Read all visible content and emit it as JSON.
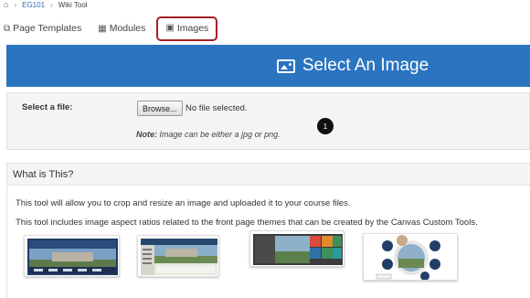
{
  "breadcrumb": {
    "items": [
      "EG101",
      "Wiki Tool"
    ]
  },
  "tabs": [
    {
      "label": "Page Templates",
      "icon": "page-templates-icon"
    },
    {
      "label": "Modules",
      "icon": "modules-icon"
    },
    {
      "label": "Images",
      "icon": "image-icon",
      "active": true
    }
  ],
  "header": {
    "title": "Select An Image"
  },
  "file_select": {
    "label": "Select a file:",
    "browse_label": "Browse...",
    "status": "No file selected.",
    "note_prefix": "Note:",
    "note_text": " Image can be either a jpg or png.",
    "callout": "1"
  },
  "info": {
    "heading": "What is This?",
    "line1": "This tool will allow you to crop and resize an image and uploaded it to your course files.",
    "line2": "This tool includes image aspect ratios related to the front page themes that can be created by the Canvas Custom Tools."
  },
  "colors": {
    "header_bg": "#2b74c0",
    "active_tab_border": "#a3202a"
  }
}
